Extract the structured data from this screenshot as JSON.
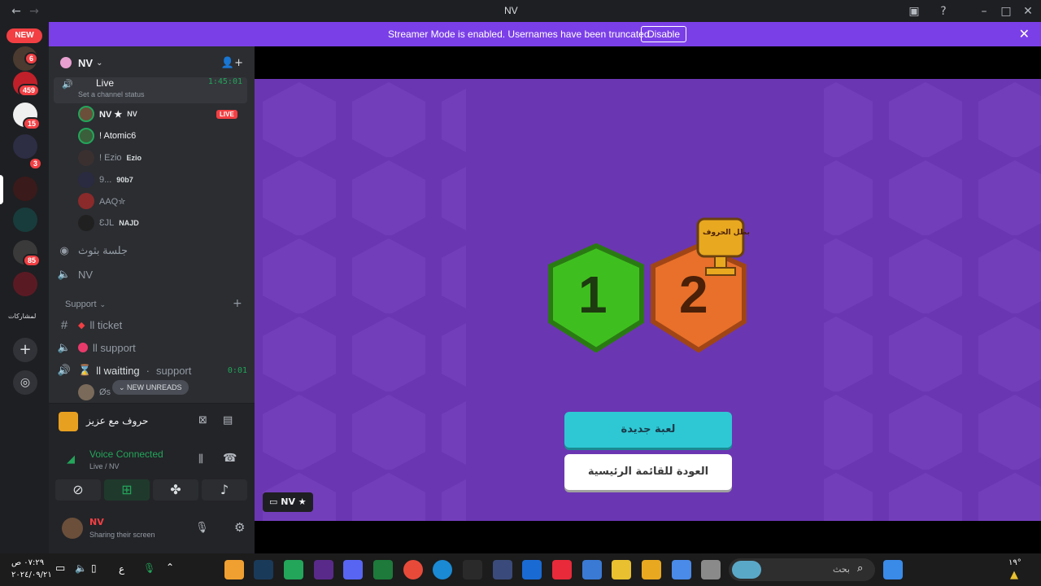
{
  "window": {
    "title": "NV"
  },
  "banner": {
    "text": "Streamer Mode is enabled. Usernames have been truncated.",
    "button": "Disable"
  },
  "servers": {
    "new_label": "NEW",
    "badges": [
      "6",
      "459",
      "15",
      "3",
      "85"
    ],
    "text_server": "لمشاركات"
  },
  "guild": {
    "name": "NV"
  },
  "channels": {
    "live": {
      "name": "Live",
      "status": "Set a channel status",
      "time": "1:45:01"
    },
    "members": [
      {
        "name": "NV ★",
        "tag": "NV",
        "live": "LIVE"
      },
      {
        "name": "! Atomic6",
        "tag": ""
      },
      {
        "name": "! Ezio",
        "tag": "Ezio"
      },
      {
        "name": "9...",
        "tag": "90b7"
      },
      {
        "name": "AAQ✮",
        "tag": ""
      },
      {
        "name": "ƐJL",
        "tag": "NAJD"
      }
    ],
    "stage": "جلسة بثوث",
    "nv_voice": "NV",
    "category": "Support",
    "ticket": "ll ticket",
    "support": "ll support",
    "waiting": "ll waitting",
    "waiting_sub": "support",
    "waiting_time": "0:01",
    "partial_member": "Øs",
    "new_unreads": "NEW UNREADS"
  },
  "activity": {
    "name": "حروف مع عزيز"
  },
  "voice": {
    "status": "Voice Connected",
    "channel": "Live / NV"
  },
  "user": {
    "name": "NV",
    "status": "Sharing their screen"
  },
  "game": {
    "team1_score": "1",
    "team2_score": "2",
    "trophy_text": "بطل الحروف",
    "new_game": "لعبة جديدة",
    "main_menu": "العودة للقائمة الرئيسية",
    "streamer_tag": "NV ★",
    "team1_color": "#3fbf1f",
    "team2_color": "#e8702a"
  },
  "taskbar": {
    "time": "٠٧:٢٩ ص",
    "date": "٢٠٢٤/٠٩/٢١",
    "lang": "ع",
    "search": "بحث",
    "temp": "١٩°"
  }
}
